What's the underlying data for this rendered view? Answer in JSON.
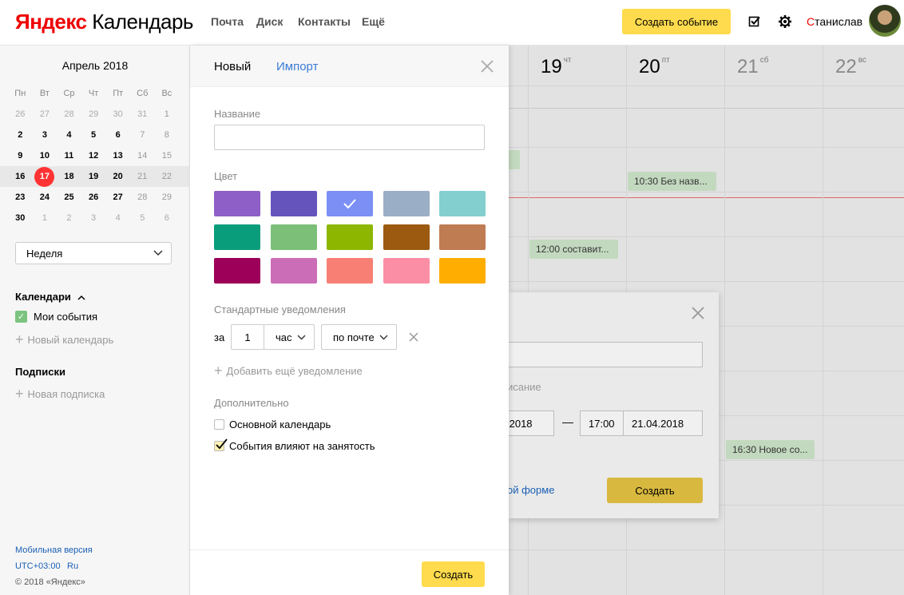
{
  "header": {
    "logo_brand": "Яндекс",
    "logo_product": "Календарь",
    "nav": [
      "Почта",
      "Диск",
      "Контакты",
      "Ещё"
    ],
    "create_event": "Создать событие",
    "user_first_letter": "С",
    "user_rest": "танислав",
    "icons": [
      "todo-check-icon",
      "gear-icon"
    ]
  },
  "sidebar": {
    "month": "Апрель 2018",
    "weekdays": [
      "Пн",
      "Вт",
      "Ср",
      "Чт",
      "Пт",
      "Сб",
      "Вс"
    ],
    "weeks": [
      [
        "26",
        "27",
        "28",
        "29",
        "30",
        "31",
        "1"
      ],
      [
        "2",
        "3",
        "4",
        "5",
        "6",
        "7",
        "8"
      ],
      [
        "9",
        "10",
        "11",
        "12",
        "13",
        "14",
        "15"
      ],
      [
        "16",
        "17",
        "18",
        "19",
        "20",
        "21",
        "22"
      ],
      [
        "23",
        "24",
        "25",
        "26",
        "27",
        "28",
        "29"
      ],
      [
        "30",
        "1",
        "2",
        "3",
        "4",
        "5",
        "6"
      ]
    ],
    "today": "17",
    "view_select": "Неделя",
    "calendars_title": "Календари",
    "my_events": "Мои события",
    "new_calendar": "Новый календарь",
    "subscriptions_title": "Подписки",
    "new_subscription": "Новая подписка",
    "mobile": "Мобильная версия",
    "tz": "UTC+03:00",
    "lang": "Ru",
    "copyright": "© 2018 «Яндекс»"
  },
  "panel": {
    "tab_new": "Новый",
    "tab_import": "Импорт",
    "name_label": "Название",
    "name_placeholder": "",
    "color_label": "Цвет",
    "colors": [
      "#8e5fc6",
      "#6654bd",
      "#7b8ff5",
      "#9aaec6",
      "#83cfcf",
      "#0a9d7c",
      "#7cbf79",
      "#8db600",
      "#9c5a10",
      "#bf7b52",
      "#9c0058",
      "#cb6db7",
      "#f77f74",
      "#fb8ea4",
      "#ffad00"
    ],
    "selected_color_index": 2,
    "notif_label": "Стандартные уведомления",
    "notif_prefix": "за",
    "notif_amount": "1",
    "notif_unit": "час",
    "notif_channel": "по почте",
    "add_notif": "Добавить ещё уведомление",
    "extra_label": "Дополнительно",
    "primary_calendar": "Основной календарь",
    "primary_checked": false,
    "affects_busy": "События влияют на занятость",
    "affects_checked": true,
    "submit": "Создать"
  },
  "grid": {
    "days": [
      {
        "num": "19",
        "dow": "чт"
      },
      {
        "num": "20",
        "dow": "пт"
      },
      {
        "num": "21",
        "dow": "сб"
      },
      {
        "num": "22",
        "dow": "вс"
      }
    ],
    "events": [
      {
        "text": "10:30 Без назв..."
      },
      {
        "text": "12:00 составит..."
      },
      {
        "text": "16:30 Новое со..."
      }
    ]
  },
  "background_dialog": {
    "description_partial": "исание",
    "start_date_partial": ".2018",
    "dash": "—",
    "end_time": "17:00",
    "end_date": "21.04.2018",
    "full_form_partial": "ой форме",
    "create": "Создать"
  }
}
